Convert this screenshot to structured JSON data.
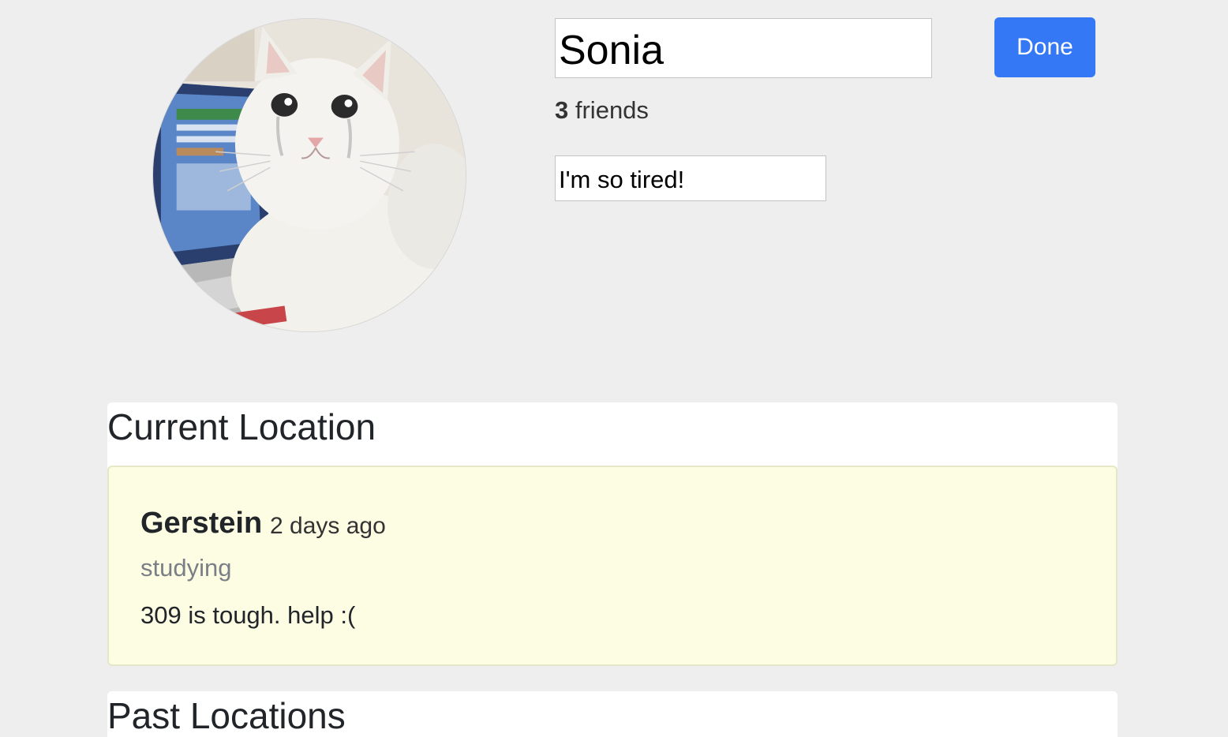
{
  "profile": {
    "avatar_icon": "profile-photo-cat",
    "name_value": "Sonia",
    "friends_count": "3",
    "friends_label": "friends",
    "status_value": "I'm so tired!",
    "done_label": "Done"
  },
  "current_location": {
    "heading": "Current Location",
    "checkin": {
      "place": "Gerstein",
      "time_ago": "2 days ago",
      "activity": "studying",
      "note": "309 is tough. help :("
    }
  },
  "past_locations": {
    "heading": "Past Locations"
  },
  "colors": {
    "background": "#eeeeee",
    "accent": "#3478f6",
    "card_background": "#fdfde3"
  }
}
